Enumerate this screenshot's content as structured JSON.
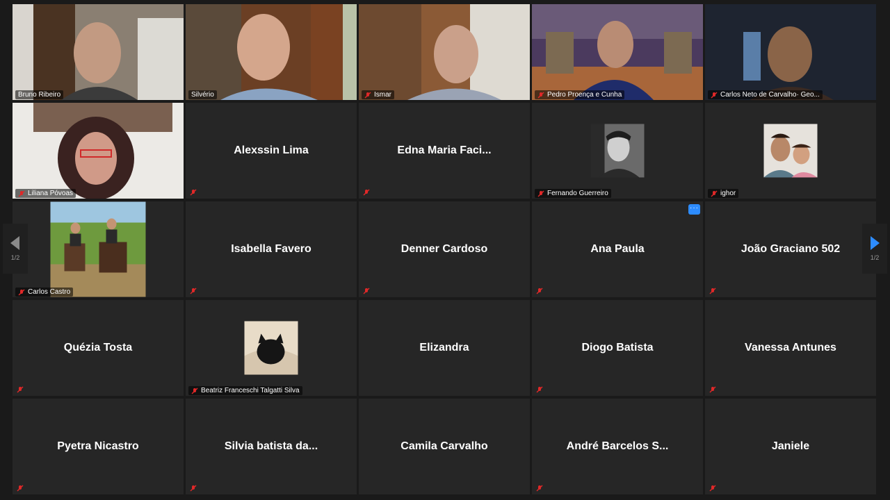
{
  "participants": [
    {
      "name": "Bruno Ribeiro",
      "muted": false,
      "active": true
    },
    {
      "name": "Silvério",
      "muted": false
    },
    {
      "name": "Ismar",
      "muted": true
    },
    {
      "name": "Pedro Proença e Cunha",
      "muted": true
    },
    {
      "name": "Carlos Neto de Carvalho· Geo...",
      "muted": true
    },
    {
      "name": "Liliana Póvoas",
      "muted": true
    },
    {
      "name": "Alexssin Lima",
      "muted": true
    },
    {
      "name": "Edna Maria Faci...",
      "muted": true
    },
    {
      "name": "Fernando Guerreiro",
      "muted": true
    },
    {
      "name": "ighor",
      "muted": true
    },
    {
      "name": "Carlos Castro",
      "muted": true
    },
    {
      "name": "Isabella Favero",
      "muted": true
    },
    {
      "name": "Denner Cardoso",
      "muted": true
    },
    {
      "name": "Ana Paula",
      "muted": true
    },
    {
      "name": "João Graciano 502",
      "muted": true
    },
    {
      "name": "Quézia Tosta",
      "muted": true
    },
    {
      "name": "Beatriz Franceschi Talgatti Silva",
      "muted": true
    },
    {
      "name": "Elizandra",
      "muted": true
    },
    {
      "name": "Diogo Batista",
      "muted": true
    },
    {
      "name": "Vanessa Antunes",
      "muted": true
    },
    {
      "name": "Pyetra Nicastro",
      "muted": true
    },
    {
      "name": "Silvia batista da...",
      "muted": true
    },
    {
      "name": "Camila Carvalho",
      "muted": true
    },
    {
      "name": "André Barcelos S...",
      "muted": true
    },
    {
      "name": "Janiele",
      "muted": true
    }
  ],
  "pagination": {
    "left_page": "1/2",
    "right_page": "1/2"
  },
  "more_options_label": "···",
  "colors": {
    "active_border": "#e8e7a0",
    "accent": "#2d8cff",
    "mute": "#e02828"
  }
}
